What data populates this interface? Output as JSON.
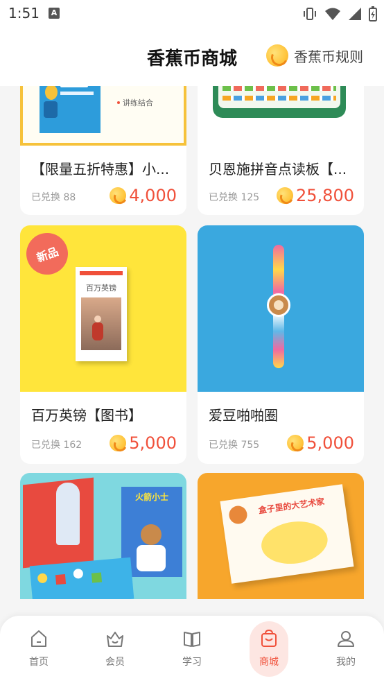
{
  "status": {
    "time": "1:51"
  },
  "header": {
    "title": "香蕉币商城",
    "rules_label": "香蕉币规则"
  },
  "products": [
    {
      "title": "【限量五折特惠】小...",
      "exchanged": "已兑换 88",
      "price": "4,000",
      "img_caption": "讲练结合"
    },
    {
      "title": "贝恩施拼音点读板【...",
      "exchanged": "已兑换 125",
      "price": "25,800"
    },
    {
      "title": "百万英镑【图书】",
      "exchanged": "已兑换 162",
      "price": "5,000",
      "badge": "新品",
      "book_title": "百万英镑"
    },
    {
      "title": "爱豆啪啪圈",
      "exchanged": "已兑换 755",
      "price": "5,000"
    },
    {
      "title": "",
      "exchanged": "",
      "price": "",
      "book_title": "火箭小士"
    },
    {
      "title": "",
      "exchanged": "",
      "price": "",
      "book_title": "盒子里的大艺术家"
    }
  ],
  "nav": [
    {
      "label": "首页",
      "icon": "home-icon"
    },
    {
      "label": "会员",
      "icon": "crown-basket-icon"
    },
    {
      "label": "学习",
      "icon": "book-icon"
    },
    {
      "label": "商城",
      "icon": "shopping-bag-icon",
      "active": true
    },
    {
      "label": "我的",
      "icon": "person-icon"
    }
  ],
  "colors": {
    "price": "#f0503a",
    "active_nav": "#f0503a",
    "badge": "#f26b5b"
  }
}
